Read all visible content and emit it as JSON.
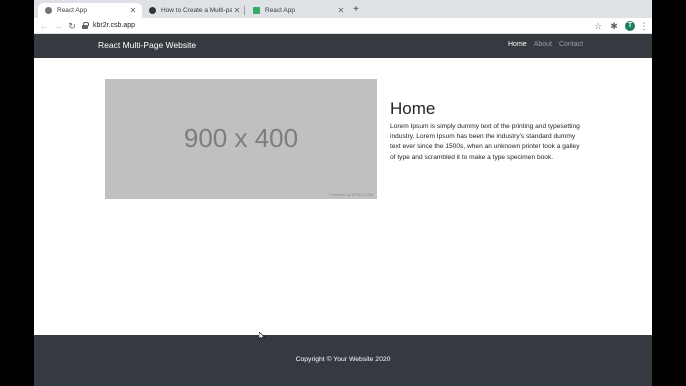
{
  "browser": {
    "tabs": [
      {
        "title": "React App",
        "active": true
      },
      {
        "title": "How to Create a Multi-page W",
        "active": false
      },
      {
        "title": "React App",
        "active": false
      }
    ],
    "address": "kbr2r.csb.app",
    "profile_initial": "T"
  },
  "icons": {
    "back": "back-arrow-icon",
    "forward": "forward-arrow-icon",
    "reload": "reload-icon",
    "lock": "lock-icon",
    "star": "star-icon",
    "extensions": "puzzle-icon",
    "menu": "kebab-menu-icon"
  },
  "navbar": {
    "brand": "React Multi-Page Website",
    "links": [
      "Home",
      "About",
      "Contact"
    ],
    "active_link": "Home"
  },
  "hero": {
    "image_text": "900 x 400",
    "image_caption": "Powered by HTML.COM",
    "heading": "Home",
    "body": "Lorem Ipsum is simply dummy text of the printing and typesetting industry. Lorem Ipsum has been the industry's standard dummy text ever since the 1500s, when an unknown printer took a galley of type and scrambled it to make a type specimen book."
  },
  "footer": {
    "text": "Copyright © Your Website 2020"
  },
  "colors": {
    "navbar_bg": "#343a40",
    "footer_bg": "#343a40",
    "placeholder_bg": "#c0c0c0",
    "tabstrip_bg": "#dee1e6"
  }
}
